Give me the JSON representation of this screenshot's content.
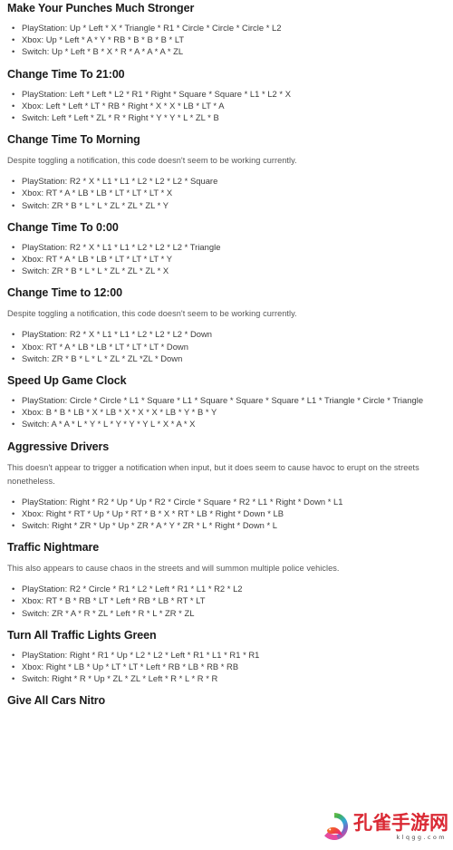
{
  "page": {
    "background_color": "#ffffff",
    "heading_color": "#1a1a1a",
    "body_color": "#555555",
    "list_color": "#3a3a3a",
    "bullet_glyph": "•"
  },
  "sections": [
    {
      "title": "Make Your Punches Much Stronger",
      "note": null,
      "codes": [
        "PlayStation: Up * Left * X * Triangle * R1 * Circle * Circle * Circle * L2",
        "Xbox: Up * Left * A * Y * RB * B * B * B * LT",
        "Switch: Up * Left * B * X * R * A * A * A * ZL"
      ]
    },
    {
      "title": "Change Time To 21:00",
      "note": null,
      "codes": [
        "PlayStation: Left * Left * L2 * R1 * Right * Square * Square * L1 * L2 * X",
        "Xbox: Left * Left * LT * RB * Right * X * X * LB * LT * A",
        "Switch: Left * Left * ZL * R * Right * Y * Y * L * ZL * B"
      ]
    },
    {
      "title": "Change Time To Morning",
      "note": "Despite toggling a notification, this code doesn't seem to be working currently.",
      "codes": [
        "PlayStation: R2 * X * L1 * L1 * L2 * L2 * L2 * Square",
        "Xbox: RT * A * LB * LB * LT * LT * LT * X",
        "Switch: ZR * B * L * L * ZL * ZL * ZL * Y"
      ]
    },
    {
      "title": "Change Time To 0:00",
      "note": null,
      "codes": [
        "PlayStation: R2 * X * L1 * L1 * L2 * L2 * L2 * Triangle",
        "Xbox: RT * A * LB * LB * LT * LT * LT * Y",
        "Switch: ZR * B * L * L * ZL * ZL * ZL * X"
      ]
    },
    {
      "title": "Change Time to 12:00",
      "note": "Despite toggling a notification, this code doesn't seem to be working currently.",
      "codes": [
        "PlayStation: R2 * X * L1 * L1 * L2 * L2 * L2 * Down",
        "Xbox: RT * A * LB * LB * LT * LT * LT * Down",
        "Switch: ZR * B * L * L * ZL * ZL *ZL * Down"
      ]
    },
    {
      "title": "Speed Up Game Clock",
      "note": null,
      "codes": [
        "PlayStation: Circle * Circle * L1 * Square * L1 * Square * Square * Square * L1 * Triangle * Circle * Triangle",
        "Xbox: B * B * LB * X * LB * X * X * X * LB * Y * B * Y",
        "Switch: A * A * L * Y * L * Y * Y * Y L * X * A * X"
      ]
    },
    {
      "title": "Aggressive Drivers",
      "note": "This doesn't appear to trigger a notification when input, but it does seem to cause havoc to erupt on the streets nonetheless.",
      "codes": [
        "PlayStation: Right * R2 * Up * Up * R2 * Circle * Square * R2 * L1 * Right * Down * L1",
        "Xbox: Right * RT * Up * Up * RT * B * X * RT * LB * Right * Down * LB",
        "Switch: Right * ZR * Up * Up * ZR * A * Y * ZR * L * Right * Down * L"
      ]
    },
    {
      "title": "Traffic Nightmare",
      "note": "This also appears to cause chaos in the streets and will summon multiple police vehicles.",
      "codes": [
        "PlayStation: R2 * Circle * R1 * L2 * Left * R1 * L1 * R2 * L2",
        "Xbox: RT * B * RB * LT * Left * RB * LB * RT * LT",
        "Switch: ZR * A * R * ZL * Left * R * L * ZR * ZL"
      ]
    },
    {
      "title": "Turn All Traffic Lights Green",
      "note": null,
      "codes": [
        "PlayStation: Right * R1 * Up * L2 * L2 * Left * R1 * L1 * R1 * R1",
        "Xbox: Right * LB * Up * LT * LT * Left * RB * LB * RB * RB",
        "Switch: Right * R * Up * ZL * ZL * Left * R * L * R * R"
      ]
    },
    {
      "title": "Give All Cars Nitro",
      "note": null,
      "codes": []
    }
  ],
  "watermark": {
    "brand_cn": "孔雀手游网",
    "url": "klqgg.com",
    "brand_color": "#d9232e",
    "mark_colors": [
      "#3fae49",
      "#2aa7d8",
      "#e8459b",
      "#f5821f"
    ]
  }
}
